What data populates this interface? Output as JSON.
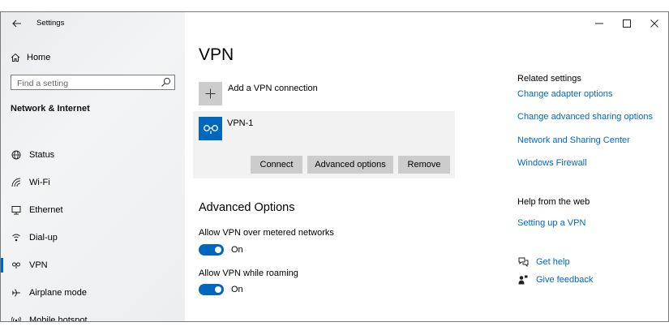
{
  "app": {
    "title": "Settings"
  },
  "window_controls": {
    "minimize": "—",
    "maximize": "☐",
    "close": "✕"
  },
  "sidebar": {
    "home_label": "Home",
    "search_placeholder": "Find a setting",
    "section_title": "Network & Internet",
    "items": [
      {
        "label": "Status",
        "icon": "globe-icon"
      },
      {
        "label": "Wi-Fi",
        "icon": "wifi-icon"
      },
      {
        "label": "Ethernet",
        "icon": "ethernet-icon"
      },
      {
        "label": "Dial-up",
        "icon": "dialup-icon"
      },
      {
        "label": "VPN",
        "icon": "vpn-icon",
        "active": true
      },
      {
        "label": "Airplane mode",
        "icon": "airplane-icon"
      },
      {
        "label": "Mobile hotspot",
        "icon": "hotspot-icon"
      }
    ]
  },
  "main": {
    "title": "VPN",
    "add_label": "Add a VPN connection",
    "connection": {
      "name": "VPN-1",
      "buttons": {
        "connect": "Connect",
        "advanced": "Advanced options",
        "remove": "Remove"
      }
    },
    "advanced": {
      "title": "Advanced Options",
      "settings": [
        {
          "label": "Allow VPN over metered networks",
          "state": "On",
          "on": true
        },
        {
          "label": "Allow VPN while roaming",
          "state": "On",
          "on": true
        }
      ]
    }
  },
  "related": {
    "heading": "Related settings",
    "links": [
      "Change adapter options",
      "Change advanced sharing options",
      "Network and Sharing Center",
      "Windows Firewall"
    ]
  },
  "help": {
    "heading": "Help from the web",
    "link": "Setting up a VPN",
    "get_help": "Get help",
    "give_feedback": "Give feedback"
  },
  "colors": {
    "accent": "#0067c0",
    "tile": "#cccccc",
    "card": "#f2f2f2"
  }
}
